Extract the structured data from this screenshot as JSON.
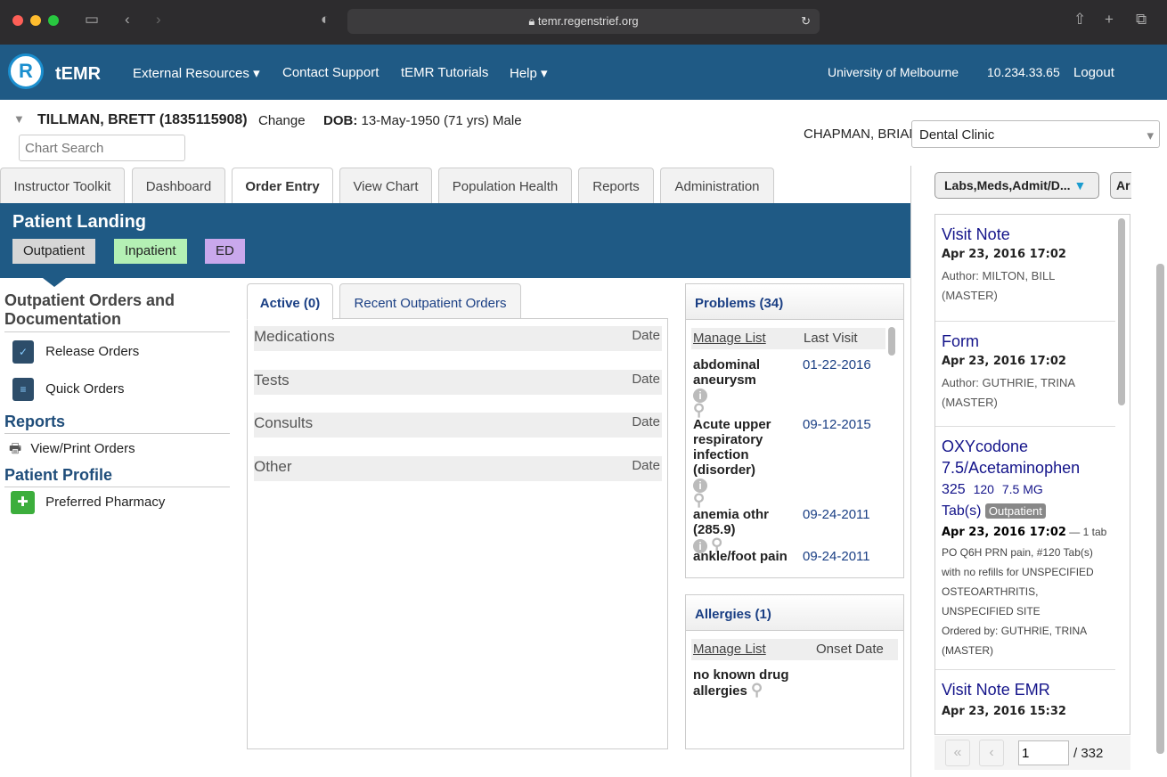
{
  "browser": {
    "url": "temr.regenstrief.org",
    "colors": {
      "close": "#fe5f57",
      "min": "#febc2e",
      "max": "#28c840"
    }
  },
  "app": {
    "logo": "tEMR",
    "nav": [
      "External Resources",
      "Contact Support",
      "tEMR Tutorials",
      "Help"
    ],
    "institution": "University of Melbourne",
    "ip": "10.234.33.65",
    "logout": "Logout"
  },
  "patient": {
    "name": "TILLMAN, BRETT (1835115908)",
    "change": "Change",
    "dob_label": "DOB:",
    "dob": "13-May-1950 (71 yrs) Male",
    "chart_search_placeholder": "Chart Search",
    "provider": "CHAPMAN, BRIAN at",
    "location": "Dental Clinic"
  },
  "tabs": [
    "Instructor Toolkit",
    "Dashboard",
    "Order Entry",
    "View Chart",
    "Population Health",
    "Reports",
    "Administration"
  ],
  "landing": {
    "title": "Patient Landing",
    "modes": [
      "Outpatient",
      "Inpatient",
      "ED"
    ]
  },
  "sidebar": {
    "heading": "Outpatient Orders and Documentation",
    "items": [
      "Release Orders",
      "Quick Orders"
    ],
    "reports_heading": "Reports",
    "reports_items": [
      "View/Print Orders"
    ],
    "profile_heading": "Patient Profile",
    "profile_items": [
      "Preferred Pharmacy"
    ]
  },
  "orders": {
    "tabs": [
      "Active (0)",
      "Recent Outpatient Orders"
    ],
    "sections": [
      "Medications",
      "Tests",
      "Consults",
      "Other"
    ],
    "date_label": "Date"
  },
  "problems": {
    "title": "Problems (34)",
    "manage": "Manage List",
    "col": "Last Visit",
    "rows": [
      {
        "name": "abdominal aneurysm",
        "date": "01-22-2016"
      },
      {
        "name": "Acute upper respiratory infection (disorder)",
        "date": "09-12-2015"
      },
      {
        "name": "anemia othr (285.9)",
        "date": "09-24-2011"
      },
      {
        "name": "ankle/foot pain",
        "date": "09-24-2011"
      }
    ]
  },
  "allergies": {
    "title": "Allergies (1)",
    "manage": "Manage List",
    "col": "Onset Date",
    "rows": [
      {
        "name": "no known drug allergies"
      }
    ]
  },
  "right": {
    "filter": "Labs,Meds,Admit/D...",
    "filter2": "Ar",
    "entries": [
      {
        "title": "Visit Note",
        "date": "Apr 23, 2016 17:02",
        "author": "Author: MILTON, BILL (MASTER)"
      },
      {
        "title": "Form",
        "date": "Apr 23, 2016 17:02",
        "author": "Author: GUTHRIE, TRINA (MASTER)"
      },
      {
        "title": "OXYcodone 7.5/Acetaminophen",
        "dose1": "325",
        "dose2": "120",
        "dose3": "7.5 MG",
        "unit": "Tab(s)",
        "badge": "Outpatient",
        "date": "Apr 23, 2016 17:02",
        "sig": "— 1 tab PO Q6H PRN pain, #120 Tab(s) with no refills for UNSPECIFIED OSTEOARTHRITIS, UNSPECIFIED SITE",
        "ordered": "Ordered by: GUTHRIE, TRINA (MASTER)"
      },
      {
        "title": "Visit Note EMR",
        "date": "Apr 23, 2016 15:32"
      }
    ],
    "page": "1",
    "pages": "/ 332"
  }
}
